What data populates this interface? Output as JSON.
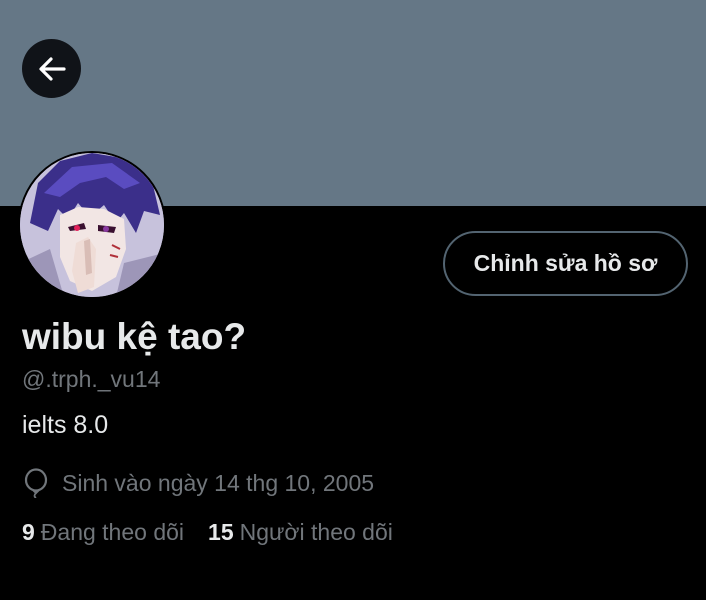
{
  "colors": {
    "banner": "#657786",
    "background": "#000000",
    "primary_text": "#e7e9ea",
    "secondary_text": "#71767b",
    "button_border": "#536471"
  },
  "header": {
    "back_icon": "arrow-left-icon"
  },
  "profile": {
    "avatar_icon": "anime-avatar",
    "edit_button_label": "Chỉnh sửa hồ sơ",
    "display_name": "wibu kệ tao?",
    "handle": "@.trph._vu14",
    "bio": "ielts 8.0",
    "birth_icon": "balloon-icon",
    "birth_text": "Sinh vào ngày 14 thg 10, 2005",
    "following_count": "9",
    "following_label": "Đang theo dõi",
    "followers_count": "15",
    "followers_label": "Người theo dõi"
  }
}
